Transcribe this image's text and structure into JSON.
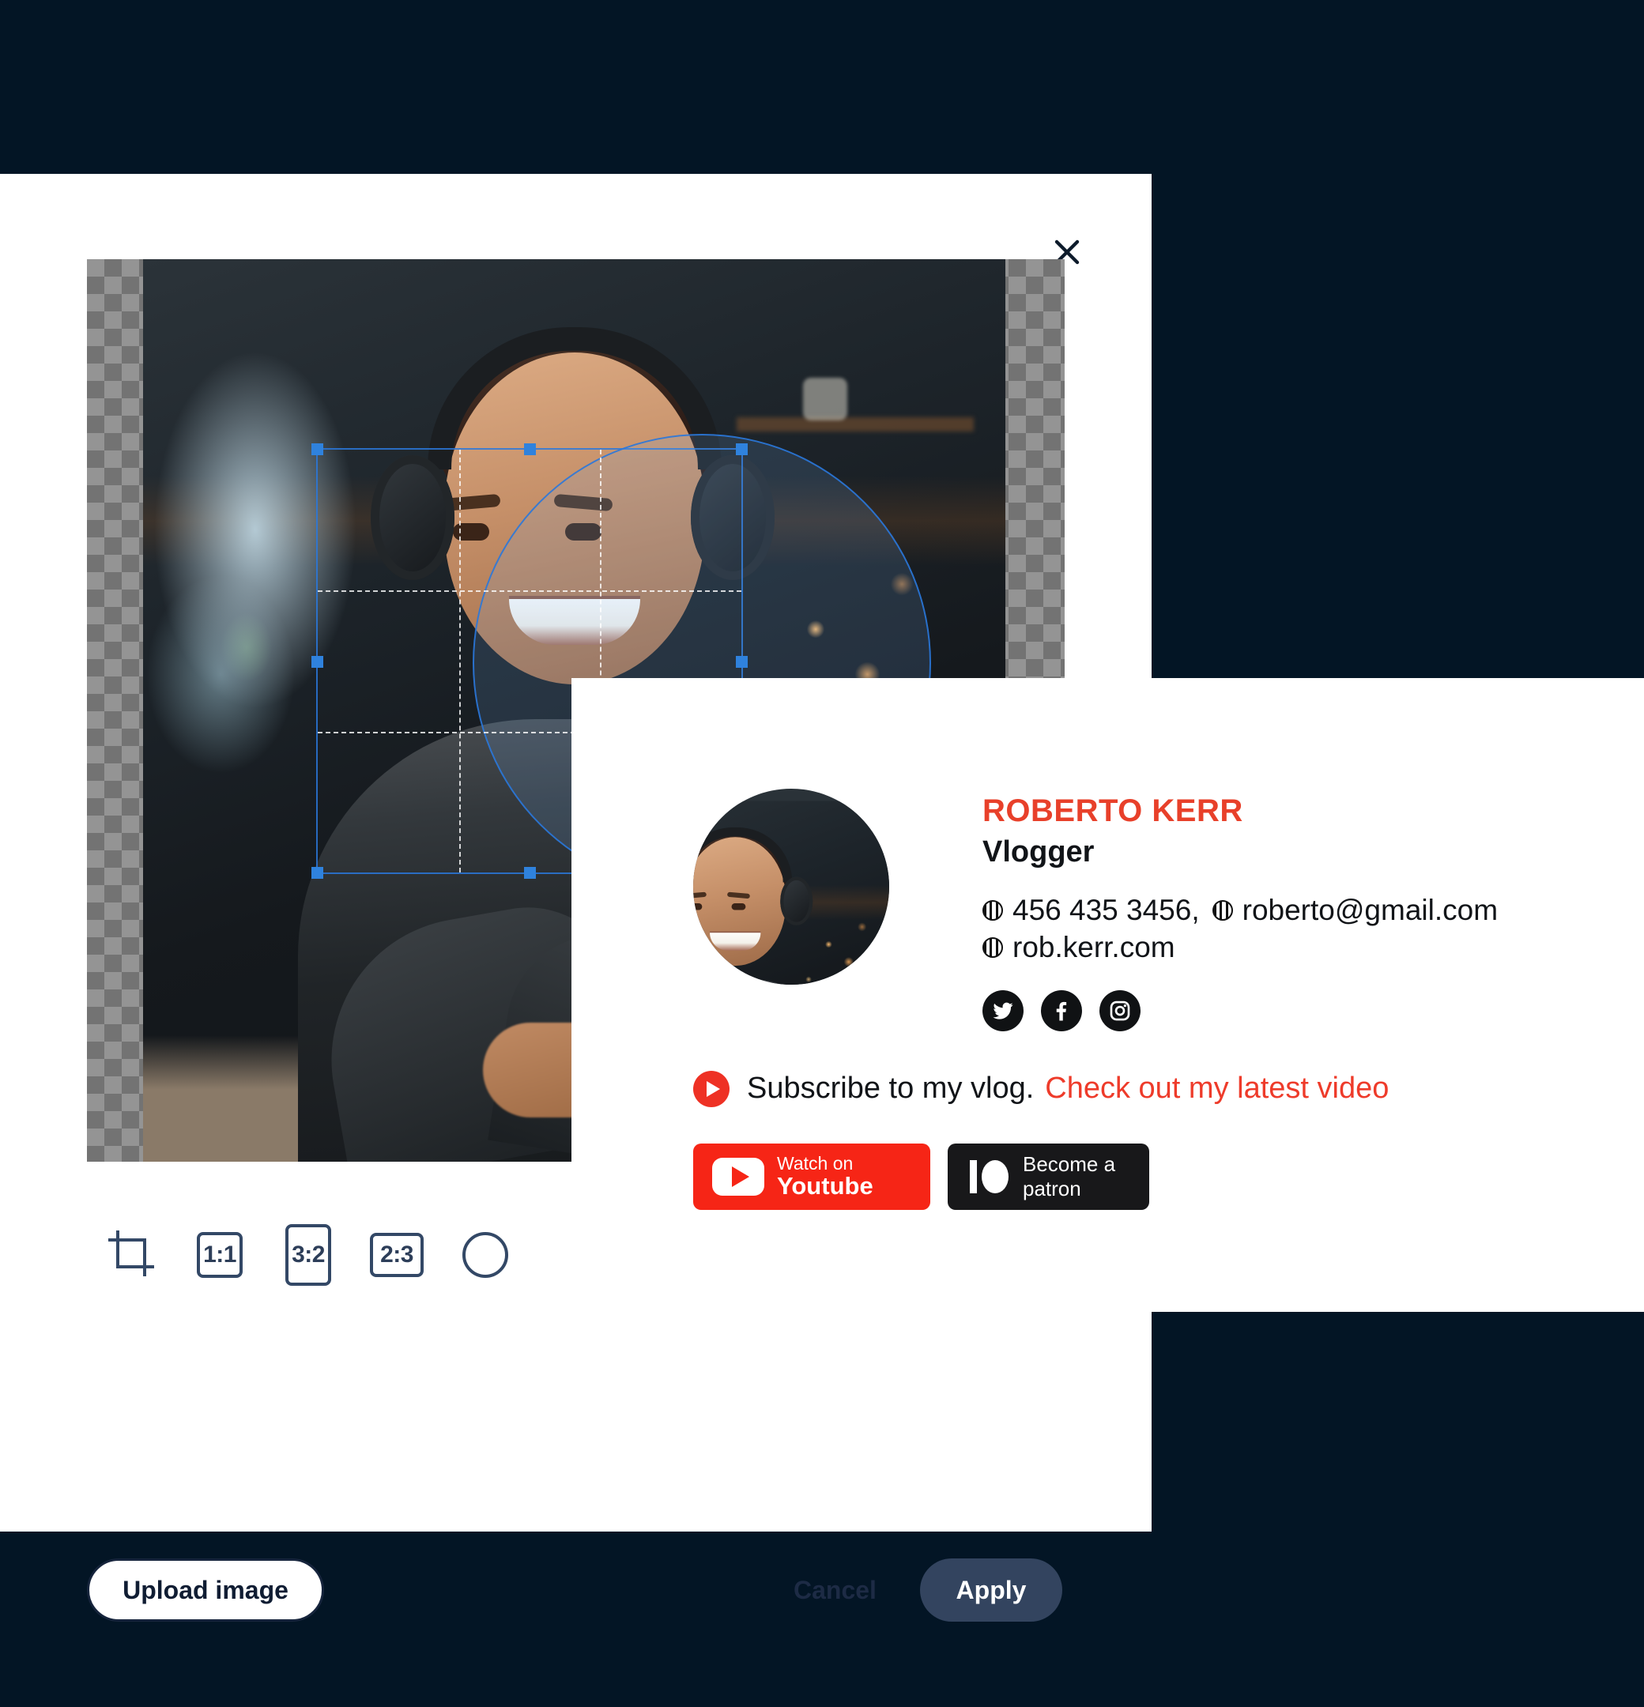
{
  "window": {
    "background_color": "#031525"
  },
  "crop_dialog": {
    "close_icon": "close-icon",
    "canvas": {
      "photo_alt": "young-vlogger-with-headphones",
      "crop_shape": "circle",
      "grid_guides": "rule-of-thirds"
    },
    "ratio_toolbar": {
      "items": [
        {
          "id": "freeform",
          "label": "",
          "icon": "crop-icon",
          "selected": false
        },
        {
          "id": "1to1",
          "label": "1:1",
          "icon": "square-icon",
          "selected": false
        },
        {
          "id": "3to2",
          "label": "3:2",
          "icon": "portrait-icon",
          "selected": false
        },
        {
          "id": "2to3",
          "label": "2:3",
          "icon": "landscape-icon",
          "selected": false
        },
        {
          "id": "circle",
          "label": "",
          "icon": "circle-icon",
          "selected": true
        }
      ]
    },
    "footer": {
      "upload_label": "Upload image",
      "cancel_label": "Cancel",
      "apply_label": "Apply"
    },
    "colors": {
      "accent_dark": "#33445f",
      "selection_blue": "#2f82dd"
    }
  },
  "signature_card": {
    "name": "ROBERTO KERR",
    "role": "Vlogger",
    "name_color": "#e8402a",
    "avatar_alt": "roberto-kerr-headshot",
    "contact": {
      "line1": {
        "phone": "456 435 3456,",
        "email": "roberto@gmail.com"
      },
      "line2": {
        "website": "rob.kerr.com"
      }
    },
    "socials": [
      {
        "id": "twitter",
        "icon": "twitter-icon"
      },
      {
        "id": "facebook",
        "icon": "facebook-icon"
      },
      {
        "id": "instagram",
        "icon": "instagram-icon"
      }
    ],
    "subscribe": {
      "icon": "youtube-play-icon",
      "text": "Subscribe to my vlog.",
      "link_text": "Check out my latest video",
      "link_color": "#ee3b2a"
    },
    "badges": {
      "youtube": {
        "line1": "Watch on",
        "line2": "Youtube",
        "color": "#f62516"
      },
      "patreon": {
        "label": "Become a patron",
        "color": "#18181a"
      }
    }
  }
}
